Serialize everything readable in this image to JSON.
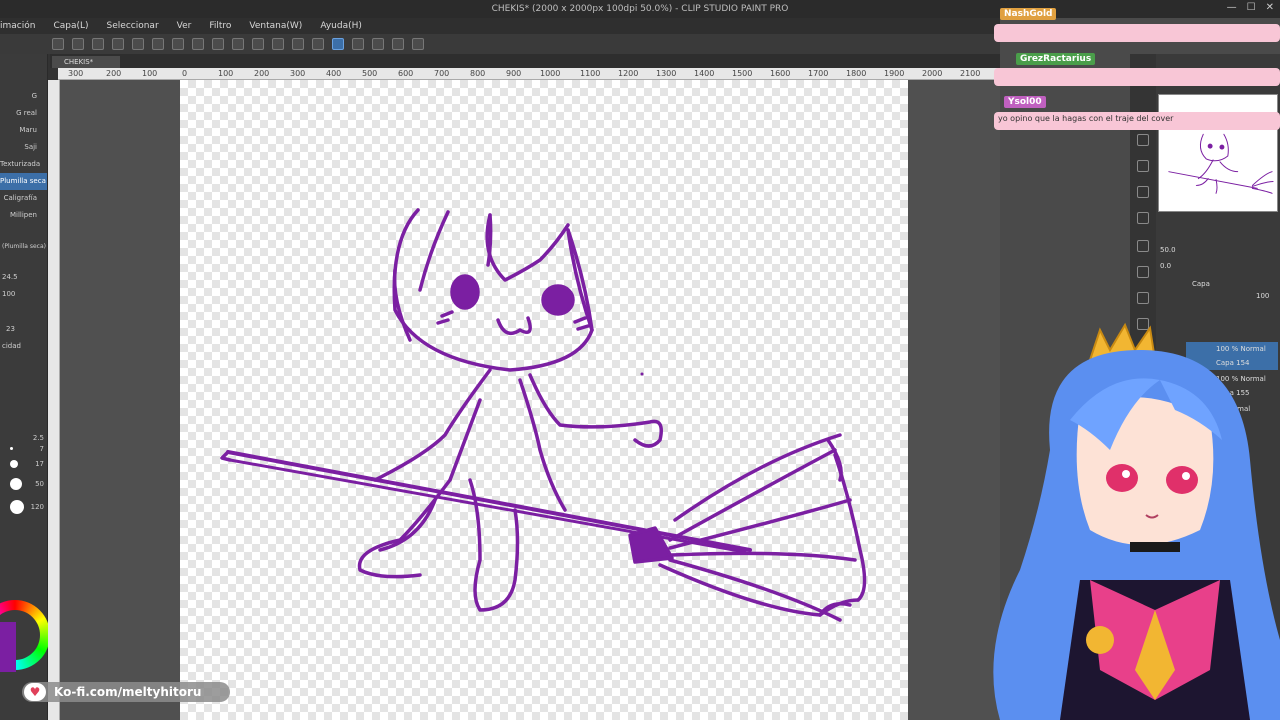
{
  "app": {
    "title": "CHEKIS* (2000 x 2000px 100dpi 50.0%) - CLIP STUDIO PAINT PRO",
    "window_controls": [
      "—",
      "☐",
      "✕"
    ]
  },
  "menu": {
    "items": [
      "imación",
      "Capa(L)",
      "Seleccionar",
      "Ver",
      "Filtro",
      "Ventana(W)",
      "Ayuda(H)"
    ]
  },
  "canvas": {
    "tab_label": "CHEKIS*",
    "ruler_labels": [
      "300",
      "200",
      "100",
      "0",
      "100",
      "200",
      "300",
      "400",
      "500",
      "600",
      "700",
      "800",
      "900",
      "1000",
      "1100",
      "1200",
      "1300",
      "1400",
      "1500",
      "1600",
      "1700",
      "1800",
      "1900",
      "2000",
      "2100"
    ],
    "stroke_color": "#7b1fa2"
  },
  "tools": {
    "items": [
      "G",
      "G real",
      "Maru",
      "Saji",
      "Texturizada",
      "Plumilla seca",
      "Caligrafía",
      "Millipen"
    ],
    "selected_index": 5,
    "brush_size": "24.5",
    "opacity": "100",
    "stabilization": "23",
    "stab_label": "cidad",
    "sub_label": "(Plumilla seca)",
    "size_values": [
      "2.5",
      "7",
      "17",
      "50",
      "120"
    ]
  },
  "navigator": {
    "zoom": "50.0",
    "rotate": "0.0"
  },
  "layers": {
    "panel_label": "Capa",
    "opacity_value": "100",
    "items": [
      {
        "mode": "100 % Normal",
        "name": "Capa 154",
        "selected": true
      },
      {
        "mode": "100 % Normal",
        "name": "Capa 155",
        "selected": false
      },
      {
        "mode": "% Normal",
        "name": "53",
        "selected": false
      }
    ]
  },
  "chat": [
    {
      "user": "NashGold",
      "message": "",
      "name_color": "#e0a040"
    },
    {
      "user": "GrezRactarius",
      "message": "",
      "name_color": "#4a9e4a"
    },
    {
      "user": "Ysol00",
      "message": "yo opino que la hagas con el traje del cover",
      "name_color": "#c060c0"
    }
  ],
  "kofi": {
    "label": "Ko-fi.com/meltyhitoru"
  }
}
